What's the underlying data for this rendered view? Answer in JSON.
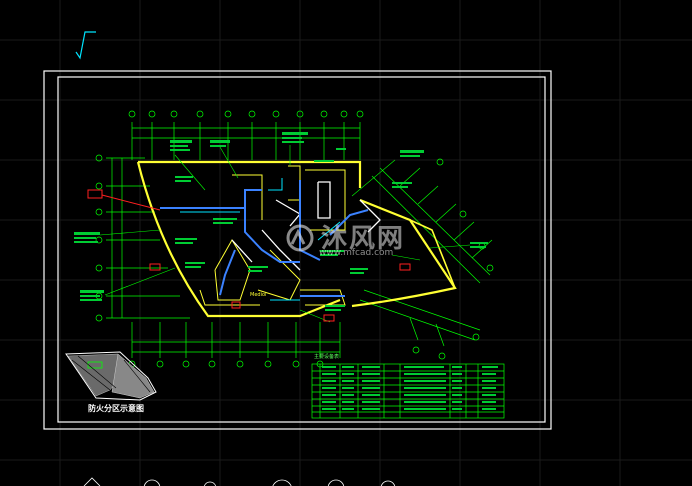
{
  "watermark": {
    "logo_text": "沐风网",
    "url_text": "www.mfcad.com"
  },
  "legend": {
    "title": "防火分区示意图"
  },
  "table": {
    "title": "主要设备表"
  },
  "labels": {
    "room_label": "Mediol"
  },
  "colors": {
    "background": "#000000",
    "frame": "#ffffff",
    "wall": "#ffff33",
    "dimension": "#00ff00",
    "duct": "#3b82ff",
    "accent_red": "#ff2020",
    "grid": "#1c1c1c"
  }
}
